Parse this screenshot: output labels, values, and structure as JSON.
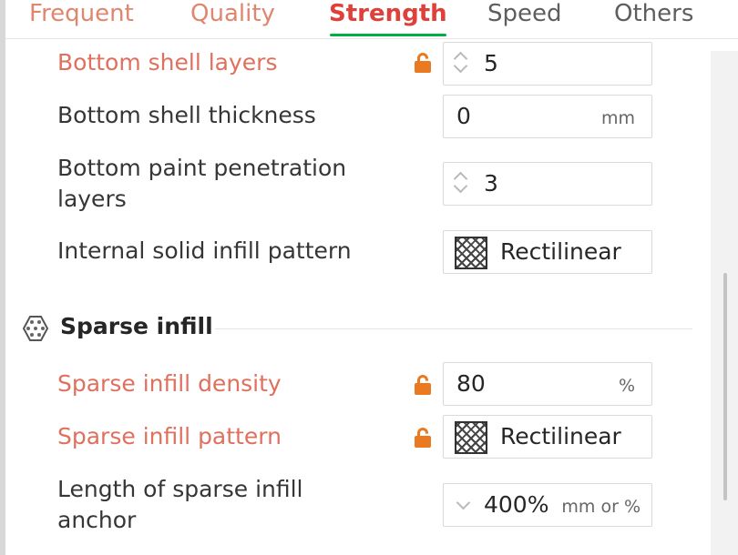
{
  "tabs": [
    {
      "label": "Frequent",
      "state": "modified"
    },
    {
      "label": "Quality",
      "state": "modified"
    },
    {
      "label": "Strength",
      "state": "active"
    },
    {
      "label": "Speed",
      "state": "normal"
    },
    {
      "label": "Others",
      "state": "normal"
    }
  ],
  "colors": {
    "active_tab": "#e0403a",
    "modified_label": "#e0705e",
    "tab_underline": "#00ae42",
    "lock": "#ea7a22"
  },
  "rows": {
    "bottom_shell_layers": {
      "label": "Bottom shell layers",
      "value": "5",
      "modified": true,
      "control": "spin"
    },
    "bottom_shell_thickness": {
      "label": "Bottom shell thickness",
      "value": "0",
      "unit": "mm"
    },
    "bottom_paint_penetration": {
      "label_line1": "Bottom paint penetration",
      "label_line2": "layers",
      "value": "3",
      "control": "spin"
    },
    "internal_solid_infill_pattern": {
      "label": "Internal solid infill pattern",
      "value": "Rectilinear",
      "icon": "rectilinear-pattern-icon"
    }
  },
  "section": {
    "title": "Sparse infill",
    "icon": "sparse-infill-icon"
  },
  "sparse_rows": {
    "density": {
      "label": "Sparse infill density",
      "value": "80",
      "unit": "%",
      "modified": true
    },
    "pattern": {
      "label": "Sparse infill pattern",
      "value": "Rectilinear",
      "modified": true,
      "icon": "rectilinear-pattern-icon"
    },
    "anchor": {
      "label_line1": "Length of sparse infill",
      "label_line2": "anchor",
      "value": "400%",
      "unit": "mm or %",
      "control": "dropdown"
    }
  }
}
